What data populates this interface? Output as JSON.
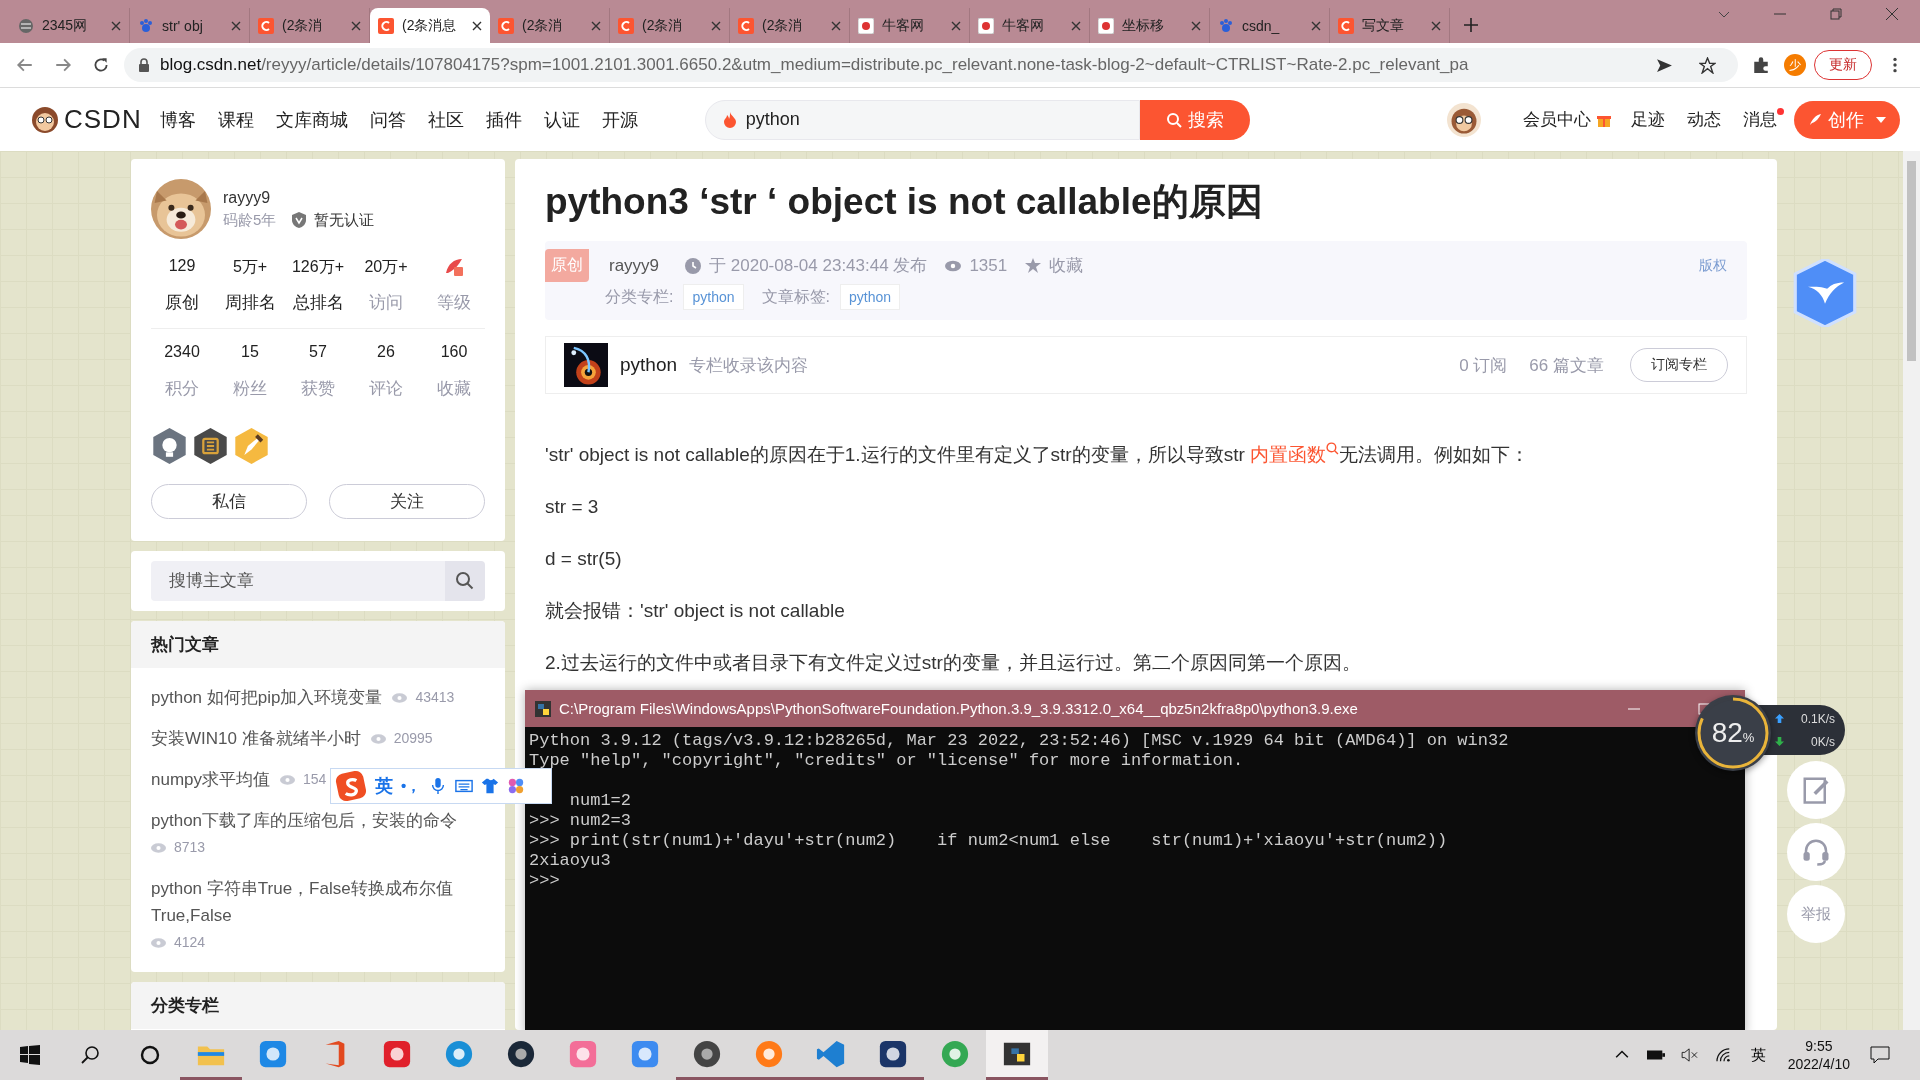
{
  "browser": {
    "tabs": [
      {
        "kind": "globe",
        "title": "2345网",
        "selected": false
      },
      {
        "kind": "paw",
        "title": "str' obj",
        "selected": false
      },
      {
        "kind": "csdn",
        "title": "(2条消",
        "selected": false
      },
      {
        "kind": "csdn",
        "title": "(2条消息",
        "selected": true
      },
      {
        "kind": "csdn",
        "title": "(2条消",
        "selected": false
      },
      {
        "kind": "csdn",
        "title": "(2条消",
        "selected": false
      },
      {
        "kind": "csdn",
        "title": "(2条消",
        "selected": false
      },
      {
        "kind": "niuke",
        "title": "牛客网",
        "selected": false
      },
      {
        "kind": "niuke",
        "title": "牛客网",
        "selected": false
      },
      {
        "kind": "niuke",
        "title": "坐标移",
        "selected": false
      },
      {
        "kind": "paw",
        "title": "csdn_",
        "selected": false
      },
      {
        "kind": "csdn",
        "title": "写文章",
        "selected": false
      }
    ],
    "url_host": "blog.csdn.net",
    "url_rest": "/reyyy/article/details/107804175?spm=1001.2101.3001.6650.2&utm_medium=distribute.pc_relevant.none-task-blog-2~default~CTRLIST~Rate-2.pc_relevant_pa",
    "profile_initial": "少",
    "update_button": "更新"
  },
  "nav": {
    "logo": "CSDN",
    "items": [
      "博客",
      "课程",
      "文库商城",
      "问答",
      "社区",
      "插件",
      "认证",
      "开源"
    ],
    "search": {
      "value": "python",
      "button": "搜索"
    },
    "links": [
      "会员中心",
      "足迹",
      "动态",
      "消息"
    ],
    "message_unread": true,
    "create_button": "创作"
  },
  "author": {
    "name": "rayyy9",
    "age": "码龄5年",
    "certification": "暂无认证",
    "stats": [
      [
        {
          "kind": "number",
          "value": "129",
          "label": "原创",
          "muted": false
        },
        {
          "kind": "number",
          "value": "5万+",
          "label": "周排名",
          "muted": false
        },
        {
          "kind": "number",
          "value": "126万+",
          "label": "总排名",
          "muted": false
        },
        {
          "kind": "number",
          "value": "20万+",
          "label": "访问",
          "muted": true
        },
        {
          "kind": "level",
          "label": "等级",
          "muted": true
        }
      ],
      [
        {
          "kind": "number",
          "value": "2340",
          "label": "积分",
          "muted": true
        },
        {
          "kind": "number",
          "value": "15",
          "label": "粉丝",
          "muted": true
        },
        {
          "kind": "number",
          "value": "57",
          "label": "获赞",
          "muted": true
        },
        {
          "kind": "number",
          "value": "26",
          "label": "评论",
          "muted": true
        },
        {
          "kind": "number",
          "value": "160",
          "label": "收藏",
          "muted": true
        }
      ]
    ],
    "buttons": [
      "私信",
      "关注"
    ]
  },
  "blog_search": {
    "placeholder": "搜博主文章"
  },
  "hot_articles": {
    "title": "热门文章",
    "items": [
      {
        "title": "python 如何把pip加入环境变量",
        "views": "43413"
      },
      {
        "title": "安装WIN10 准备就绪半小时",
        "views": "20995"
      },
      {
        "title": "numpy求平均值",
        "views": "154"
      },
      {
        "title": "python下载了库的压缩包后，安装的命令",
        "views": "8713"
      },
      {
        "title": "python 字符串True，False转换成布尔值True,False",
        "views": "4124"
      }
    ]
  },
  "columns_section": {
    "title": "分类专栏"
  },
  "article": {
    "title": "python3 ‘str ‘ object is not callable的原因",
    "badge": "原创",
    "author": "rayyy9",
    "published": "于 2020-08-04 23:43:44 发布",
    "views": "1351",
    "favorite": "收藏",
    "copyright": "版权",
    "category_label": "分类专栏:",
    "category_tag": "python",
    "tags_label": "文章标签:",
    "tag": "python",
    "column": {
      "name": "python",
      "note": "专栏收录该内容",
      "subscribers": "0 订阅",
      "articles": "66 篇文章",
      "button": "订阅专栏"
    },
    "paragraphs": [
      {
        "before": "'str' object is not callable的原因在于1.运行的文件里有定义了str的变量，所以导致str ",
        "link": "内置函数",
        "after": "无法调用。例如如下："
      },
      {
        "before": "str = 3"
      },
      {
        "before": "d = str(5)"
      },
      {
        "before": "就会报错：'str' object is not callable"
      },
      {
        "before": "2.过去运行的文件中或者目录下有文件定义过str的变量，并且运行过。第二个原因同第一个原因。"
      }
    ]
  },
  "side_tools": {
    "report": "举报"
  },
  "terminal": {
    "title": "C:\\Program Files\\WindowsApps\\PythonSoftwareFoundation.Python.3.9_3.9.3312.0_x64__qbz5n2kfra8p0\\python3.9.exe",
    "lines": [
      {
        "text": "Python 3.9.12 (tags/v3.9.12:b28265d, Mar 23 2022, 23:52:46) [MSC v.1929 64 bit (AMD64)] on win32",
        "gap_before": false
      },
      {
        "text": "Type \"help\", \"copyright\", \"credits\" or \"license\" for more information.",
        "gap_before": false
      },
      {
        "text": "    num1=2",
        "gap_before": true
      },
      {
        "text": ">>> num2=3",
        "gap_before": false
      },
      {
        "text": ">>> print(str(num1)+'dayu'+str(num2)    if num2<num1 else    str(num1)+'xiaoyu'+str(num2))",
        "gap_before": false
      },
      {
        "text": "2xiaoyu3",
        "gap_before": false
      },
      {
        "text": ">>>",
        "gap_before": false
      }
    ]
  },
  "ime": {
    "mode": "英",
    "punct": "•，"
  },
  "net_monitor": {
    "percent": "82",
    "unit": "%",
    "up": "0.1K/s",
    "down": "0K/s"
  },
  "taskbar": {
    "apps": [
      {
        "kind": "explorer",
        "running": true,
        "active": false
      },
      {
        "kind": "star",
        "running": false,
        "active": false
      },
      {
        "kind": "office",
        "running": false,
        "active": false
      },
      {
        "kind": "music",
        "running": false,
        "active": false
      },
      {
        "kind": "edge",
        "running": false,
        "active": false
      },
      {
        "kind": "steam",
        "running": false,
        "active": false
      },
      {
        "kind": "bili",
        "running": false,
        "active": false
      },
      {
        "kind": "bird",
        "running": false,
        "active": false
      },
      {
        "kind": "camera",
        "running": true,
        "active": false
      },
      {
        "kind": "firefox",
        "running": true,
        "active": false
      },
      {
        "kind": "vscode",
        "running": true,
        "active": false
      },
      {
        "kind": "devcpp",
        "running": true,
        "active": false
      },
      {
        "kind": "chrome",
        "running": false,
        "active": false
      },
      {
        "kind": "python",
        "running": true,
        "active": true
      }
    ],
    "ime": "英",
    "time": "9:55",
    "date": "2022/4/10"
  }
}
